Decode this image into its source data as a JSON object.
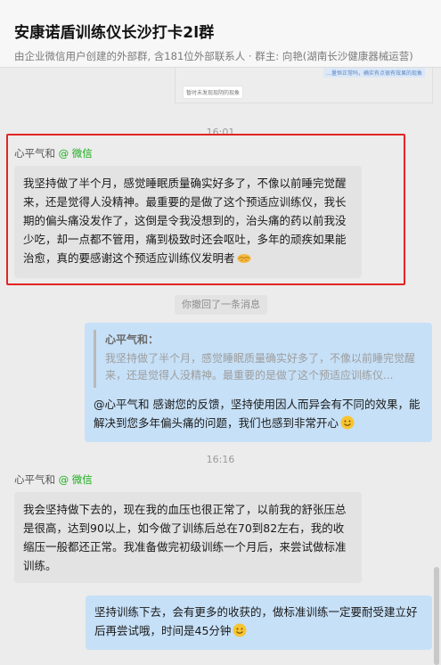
{
  "header": {
    "title": "安康诺盾训练仪长沙打卡2l群",
    "subtitle": "由企业微信用户创建的外部群, 含181位外部联系人 · 群主: 向艳(湖南长沙健康器械运营)"
  },
  "top_image": {
    "line1": "…量恒正常吗，确实有点很有效果的现象",
    "line2": "暂时未发现现阴的现象"
  },
  "time_1": "16:01",
  "msg1": {
    "sender_name": "心平气和",
    "sender_source": "@ 微信",
    "text": "我坚持做了半个月，感觉睡眠质量确实好多了，不像以前睡完觉醒来，还是觉得人没精神。最重要的是做了这个预适应训练仪，我长期的偏头痛没发作了，这倒是令我没想到的，治头痛的药以前我没少吃，却一点都不管用，痛到极致时还会呕吐，多年的顽疾如果能治愈，真的要感谢这个预适应训练仪发明者",
    "emoji": "handshake-emoji"
  },
  "recall_notice": "你撤回了一条消息",
  "msg2": {
    "quote_name": "心平气和：",
    "quote_text": "我坚持做了半个月，感觉睡眠质量确实好多了，不像以前睡完觉醒来，还是觉得人没精神。最重要的是做了这个预适应训练仪...",
    "text": "@心平气和  感谢您的反馈，坚持使用因人而异会有不同的效果，能解决到您多年偏头痛的问题，我们也感到非常开心",
    "emoji": "smile-emoji"
  },
  "time_2": "16:16",
  "msg3": {
    "sender_name": "心平气和",
    "sender_source": "@ 微信",
    "text": "我会坚持做下去的，现在我的血压也很正常了，以前我的舒张压总是很高，达到90以上，如今做了训练后总在70到82左右，我的收缩压一般都还正常。我准备做完初级训练一个月后，来尝试做标准训练。"
  },
  "msg4": {
    "text": "坚持训练下去，会有更多的收获的，做标准训练一定要耐受建立好后再尝试哦，时间是45分钟",
    "emoji": "smile-emoji"
  },
  "colors": {
    "highlight_border": "#e32424",
    "wechat_green": "#1aad19",
    "outgoing_bubble": "#c6e0f7",
    "incoming_bubble": "#e3e3e3"
  }
}
